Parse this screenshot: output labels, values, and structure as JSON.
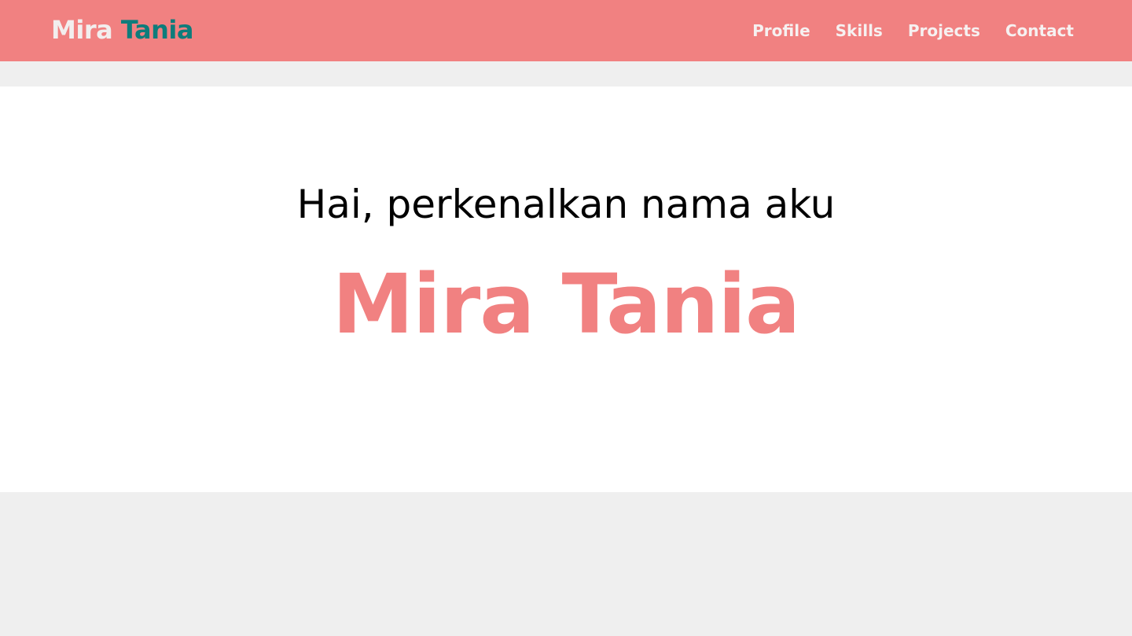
{
  "brand": {
    "first": "Mira",
    "last": "Tania"
  },
  "nav": {
    "items": [
      {
        "label": "Profile"
      },
      {
        "label": "Skills"
      },
      {
        "label": "Projects"
      },
      {
        "label": "Contact"
      }
    ]
  },
  "hero": {
    "greeting": "Hai, perkenalkan nama aku",
    "name": "Mira Tania"
  },
  "colors": {
    "accent": "#f18181",
    "brand_secondary": "#0e7c7b",
    "page_background": "#efefef",
    "hero_background": "#ffffff"
  }
}
